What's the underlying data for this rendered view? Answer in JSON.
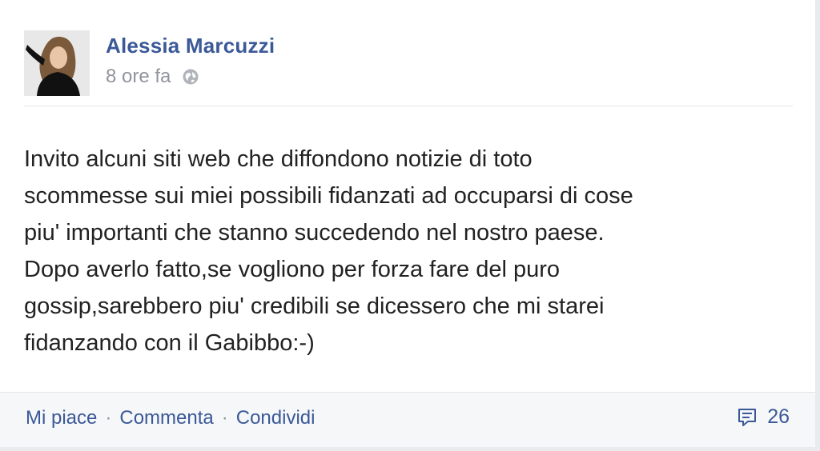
{
  "post": {
    "author": "Alessia Marcuzzi",
    "time": "8 ore fa",
    "privacy_icon": "globe-icon",
    "text": "Invito alcuni siti web che diffondono notizie di toto\nscommesse sui miei possibili fidanzati ad occuparsi di cose\npiu' importanti che stanno succedendo nel nostro paese.\nDopo averlo fatto,se vogliono per forza fare del puro\ngossip,sarebbero piu' credibili se dicessero che mi starei\nfidanzando con il Gabibbo:-)"
  },
  "actions": {
    "like": "Mi piace",
    "comment": "Commenta",
    "share": "Condividi",
    "separator": "·"
  },
  "comments": {
    "count": "26",
    "icon": "comment-icon"
  },
  "colors": {
    "link": "#3b5998",
    "meta": "#90949c",
    "text": "#222222",
    "footer_bg": "#f6f7f9"
  }
}
